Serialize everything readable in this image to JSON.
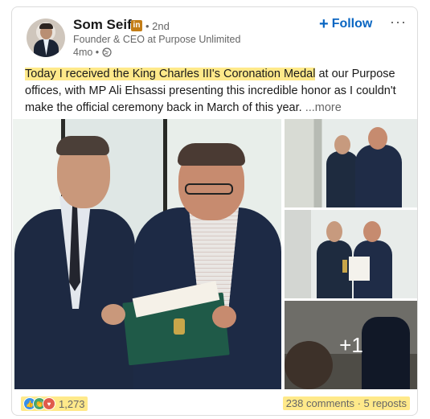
{
  "author": {
    "name": "Som Seif",
    "badge": "in",
    "degree": "• 2nd",
    "headline": "Founder & CEO at Purpose Unlimited",
    "time": "4mo •"
  },
  "actions": {
    "follow_label": "Follow",
    "follow_plus": "+",
    "more_label": "···"
  },
  "post": {
    "highlight": "Today I received the King Charles III's Coronation Medal",
    "body": " at our Purpose offices, with MP Ali Ehsassi presenting this incredible honor as I couldn't make the official ceremony back in March of this year.",
    "see_more": "...more"
  },
  "media": {
    "extra_count": "+1"
  },
  "social": {
    "reaction_count": "1,273",
    "comments_reposts": "238 comments · 5 reposts",
    "reaction_icons": [
      "like-icon",
      "celebrate-icon",
      "love-icon"
    ]
  },
  "colors": {
    "accent": "#0a66c2",
    "highlight": "#ffe98a",
    "premium_badge": "#c37d16"
  }
}
